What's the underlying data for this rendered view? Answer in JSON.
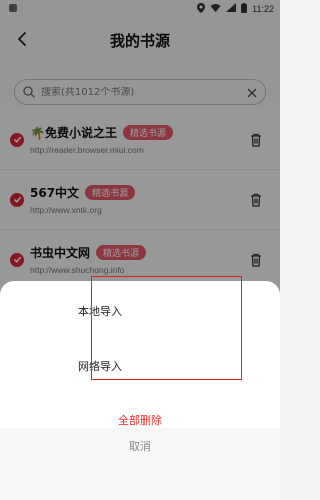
{
  "status_bar": {
    "time": "11:22"
  },
  "header": {
    "title": "我的书源"
  },
  "search": {
    "placeholder": "搜索(共1012个书源)"
  },
  "sources": [
    {
      "name": "🌴免费小说之王",
      "tag": "精选书源",
      "url": "http://reader.browser.miui.com"
    },
    {
      "name": "567中文",
      "tag": "精选书源",
      "url": "http://www.xntk.org"
    },
    {
      "name": "书虫中文网",
      "tag": "精选书源",
      "url": "http://www.shuchong.info"
    }
  ],
  "sheet": {
    "local_import": "本地导入",
    "network_import": "网络导入",
    "delete_all": "全部删除",
    "cancel": "取消"
  },
  "colors": {
    "accent_red": "#d7263d",
    "tag_pink": "#e25766",
    "delete_red": "#e52c2c"
  }
}
